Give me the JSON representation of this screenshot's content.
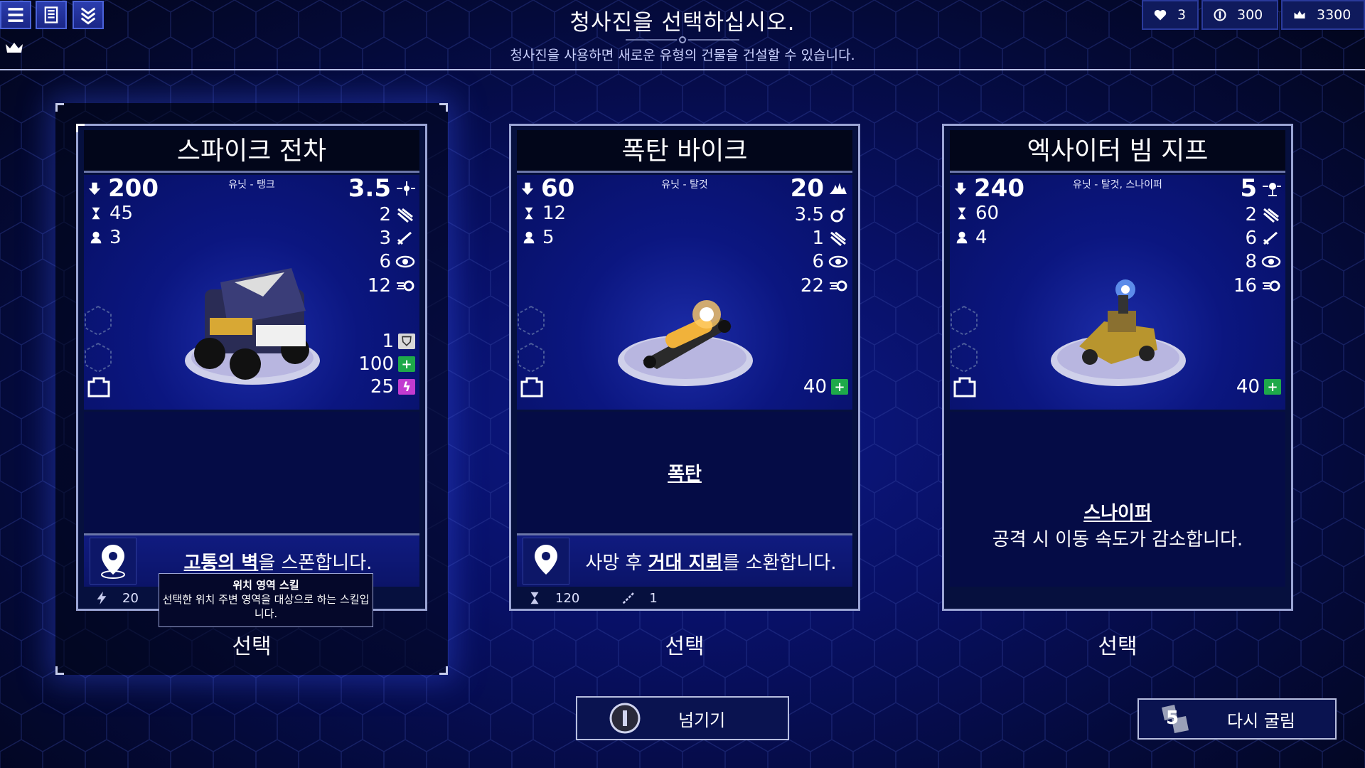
{
  "header": {
    "title": "청사진을 선택하십시오.",
    "subtitle": "청사진을 사용하면 새로운 유형의 건물을 건설할 수 있습니다.",
    "menu_icons": [
      "menu-icon",
      "deck-icon",
      "upgrade-icon"
    ]
  },
  "resources": {
    "lives": "3",
    "coins": "300",
    "crowns": "3300"
  },
  "cards": [
    {
      "name": "스파이크 전차",
      "type": "유닛 - 탱크",
      "attack": "200",
      "cooldown": "45",
      "count": "3",
      "speed": "3.5",
      "stat2": "2",
      "stat3": "3",
      "vision": "6",
      "range": "12",
      "armor": "1",
      "health": "100",
      "energy": "25",
      "description_title": "",
      "description_text": "",
      "ability_bold": "고통의 벽",
      "ability_rest": "을 스폰합니다.",
      "foot_energy": "20",
      "select_label": "선택",
      "selected": true
    },
    {
      "name": "폭탄 바이크",
      "type": "유닛 - 탈것",
      "attack": "60",
      "cooldown": "12",
      "count": "5",
      "speed": "20",
      "stat2": "3.5",
      "stat3": "1",
      "vision": "6",
      "range": "22",
      "health": "40",
      "description_title": "폭탄",
      "description_text": "",
      "ability_pre": "사망 후 ",
      "ability_bold": "거대 지뢰",
      "ability_rest": "를 소환합니다.",
      "foot_cooldown": "120",
      "foot_uses": "1",
      "select_label": "선택",
      "selected": false
    },
    {
      "name": "엑사이터 빔 지프",
      "type": "유닛 - 탈것, 스나이퍼",
      "attack": "240",
      "cooldown": "60",
      "count": "4",
      "speed": "5",
      "stat2": "2",
      "stat3": "6",
      "vision": "8",
      "range": "16",
      "health": "40",
      "description_title": "스나이퍼",
      "description_text": "공격 시 이동 속도가 감소합니다.",
      "select_label": "선택",
      "selected": false
    }
  ],
  "tooltip": {
    "title": "위치 영역 스킬",
    "text": "선택한 위치 주변 영역을 대상으로 하는 스킬입니다."
  },
  "buttons": {
    "skip_label": "넘기기",
    "reroll_label": "다시 굴림",
    "reroll_count": "5"
  },
  "colors": {
    "accent": "#4a62d8",
    "health_green": "#1ea94a",
    "energy_magenta": "#c13bd0"
  }
}
